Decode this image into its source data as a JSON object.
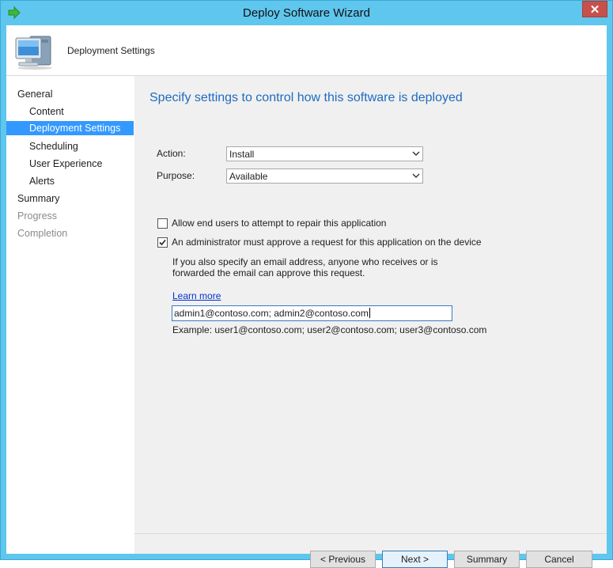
{
  "window": {
    "title": "Deploy Software Wizard",
    "close_glyph": "✕"
  },
  "header": {
    "title": "Deployment Settings",
    "icon": "computer-icon"
  },
  "nav": {
    "items": [
      {
        "label": "General",
        "state": "normal"
      },
      {
        "label": "Content",
        "state": "normal"
      },
      {
        "label": "Deployment Settings",
        "state": "selected"
      },
      {
        "label": "Scheduling",
        "state": "normal"
      },
      {
        "label": "User Experience",
        "state": "normal"
      },
      {
        "label": "Alerts",
        "state": "normal"
      },
      {
        "label": "Summary",
        "state": "normal"
      },
      {
        "label": "Progress",
        "state": "disabled"
      },
      {
        "label": "Completion",
        "state": "disabled"
      }
    ]
  },
  "main": {
    "heading": "Specify settings to control how this software is deployed",
    "action": {
      "label": "Action:",
      "value": "Install"
    },
    "purpose": {
      "label": "Purpose:",
      "value": "Available"
    },
    "repair_checkbox": {
      "label": "Allow end users to attempt to repair this application",
      "checked": false
    },
    "approve_checkbox": {
      "label": "An administrator must approve a request for this application on the device",
      "checked": true
    },
    "info_text": "If you also specify an email address, anyone who receives or is forwarded the email can approve this request.",
    "learn_more": "Learn more",
    "email_value": "admin1@contoso.com; admin2@contoso.com",
    "example_text": "Example: user1@contoso.com; user2@contoso.com; user3@contoso.com"
  },
  "buttons": {
    "previous": "< Previous",
    "next": "Next >",
    "summary": "Summary",
    "cancel": "Cancel"
  },
  "colors": {
    "frame": "#5fc6ee",
    "selection": "#3399ff",
    "heading": "#1f6bc1",
    "link": "#0033cc"
  }
}
